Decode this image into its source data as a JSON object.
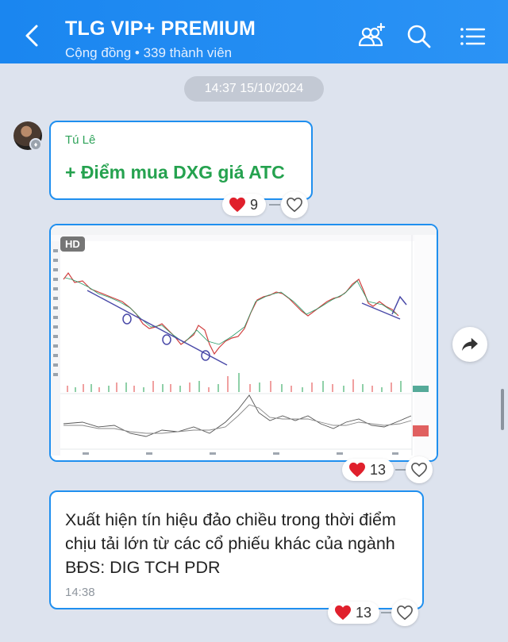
{
  "header": {
    "title": "TLG VIP+ PREMIUM",
    "subtitle": "Cộng đồng • 339 thành viên",
    "icons": [
      "back-arrow-icon",
      "group-add-icon",
      "search-icon",
      "menu-list-icon"
    ],
    "background": "#1f8fef"
  },
  "date_separator": "14:37 15/10/2024",
  "messages": [
    {
      "sender": "Tú Lê",
      "text": "+ Điểm mua DXG giá ATC",
      "reaction": {
        "emoji": "heart",
        "count": "9"
      }
    },
    {
      "type": "image",
      "badge": "HD",
      "image_description_icon": "stock-chart-image",
      "reaction": {
        "emoji": "heart",
        "count": "13"
      }
    },
    {
      "text": "Xuất hiện tín hiệu đảo chiều trong thời điểm chịu tải lớn từ các cổ phiếu khác của ngành BĐS: DIG TCH PDR",
      "time": "14:38",
      "reaction": {
        "emoji": "heart",
        "count": "13"
      }
    }
  ],
  "colors": {
    "accent": "#1f8fef",
    "sender_name": "#2fa35a",
    "buy_text": "#25a24f",
    "heart": "#e0202c"
  }
}
